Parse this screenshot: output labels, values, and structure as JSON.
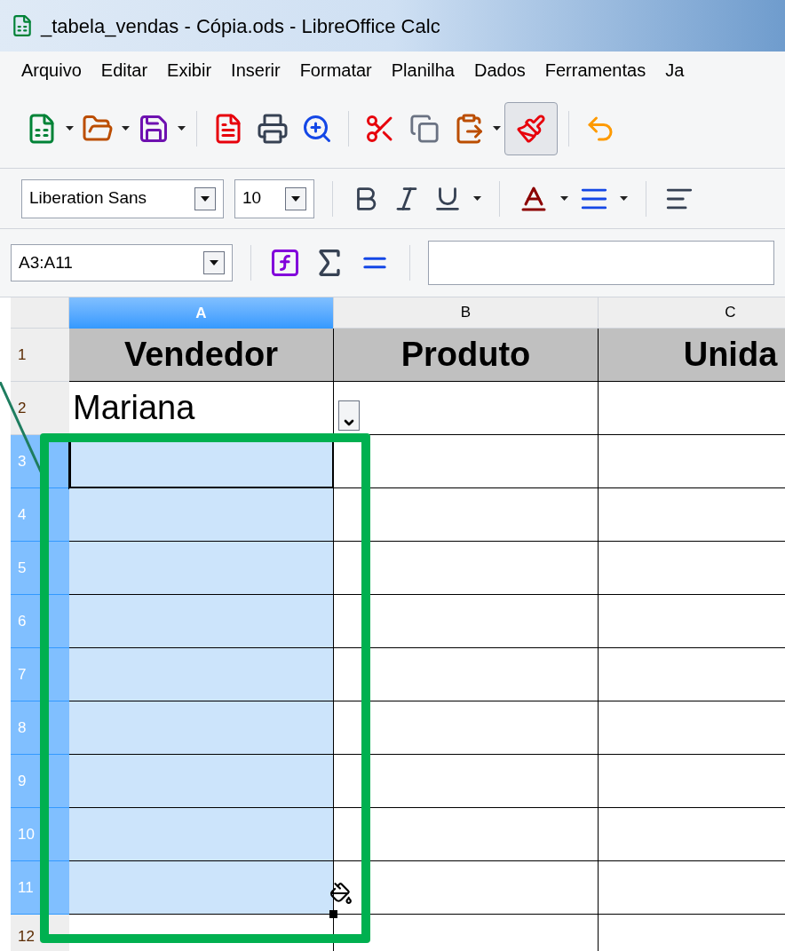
{
  "window": {
    "title": "_tabela_vendas - Cópia.ods - LibreOffice Calc"
  },
  "menu": [
    "Arquivo",
    "Editar",
    "Exibir",
    "Inserir",
    "Formatar",
    "Planilha",
    "Dados",
    "Ferramentas",
    "Ja"
  ],
  "formatting": {
    "font": "Liberation Sans",
    "size": "10"
  },
  "formula_bar": {
    "name_box": "A3:A11"
  },
  "columns": [
    {
      "label": "A",
      "selected": true
    },
    {
      "label": "B",
      "selected": false
    },
    {
      "label": "C",
      "selected": false
    }
  ],
  "rows": [
    {
      "number": "1",
      "kind": "header",
      "selected": false,
      "active": false,
      "cells": [
        "Vendedor",
        "Produto",
        "Unida"
      ]
    },
    {
      "number": "2",
      "kind": "data",
      "selected": false,
      "active": false,
      "cells": [
        "Mariana"
      ],
      "list_button": true
    },
    {
      "number": "3",
      "kind": "data",
      "selected": true,
      "active": true,
      "cells": []
    },
    {
      "number": "4",
      "kind": "data",
      "selected": true,
      "active": false,
      "cells": []
    },
    {
      "number": "5",
      "kind": "data",
      "selected": true,
      "active": false,
      "cells": []
    },
    {
      "number": "6",
      "kind": "data",
      "selected": true,
      "active": false,
      "cells": []
    },
    {
      "number": "7",
      "kind": "data",
      "selected": true,
      "active": false,
      "cells": []
    },
    {
      "number": "8",
      "kind": "data",
      "selected": true,
      "active": false,
      "cells": []
    },
    {
      "number": "9",
      "kind": "data",
      "selected": true,
      "active": false,
      "cells": []
    },
    {
      "number": "10",
      "kind": "data",
      "selected": true,
      "active": false,
      "cells": []
    },
    {
      "number": "11",
      "kind": "data",
      "selected": true,
      "active": false,
      "cells": [],
      "fill_handle": true
    },
    {
      "number": "12",
      "kind": "data",
      "selected": false,
      "active": false,
      "cells": []
    }
  ]
}
